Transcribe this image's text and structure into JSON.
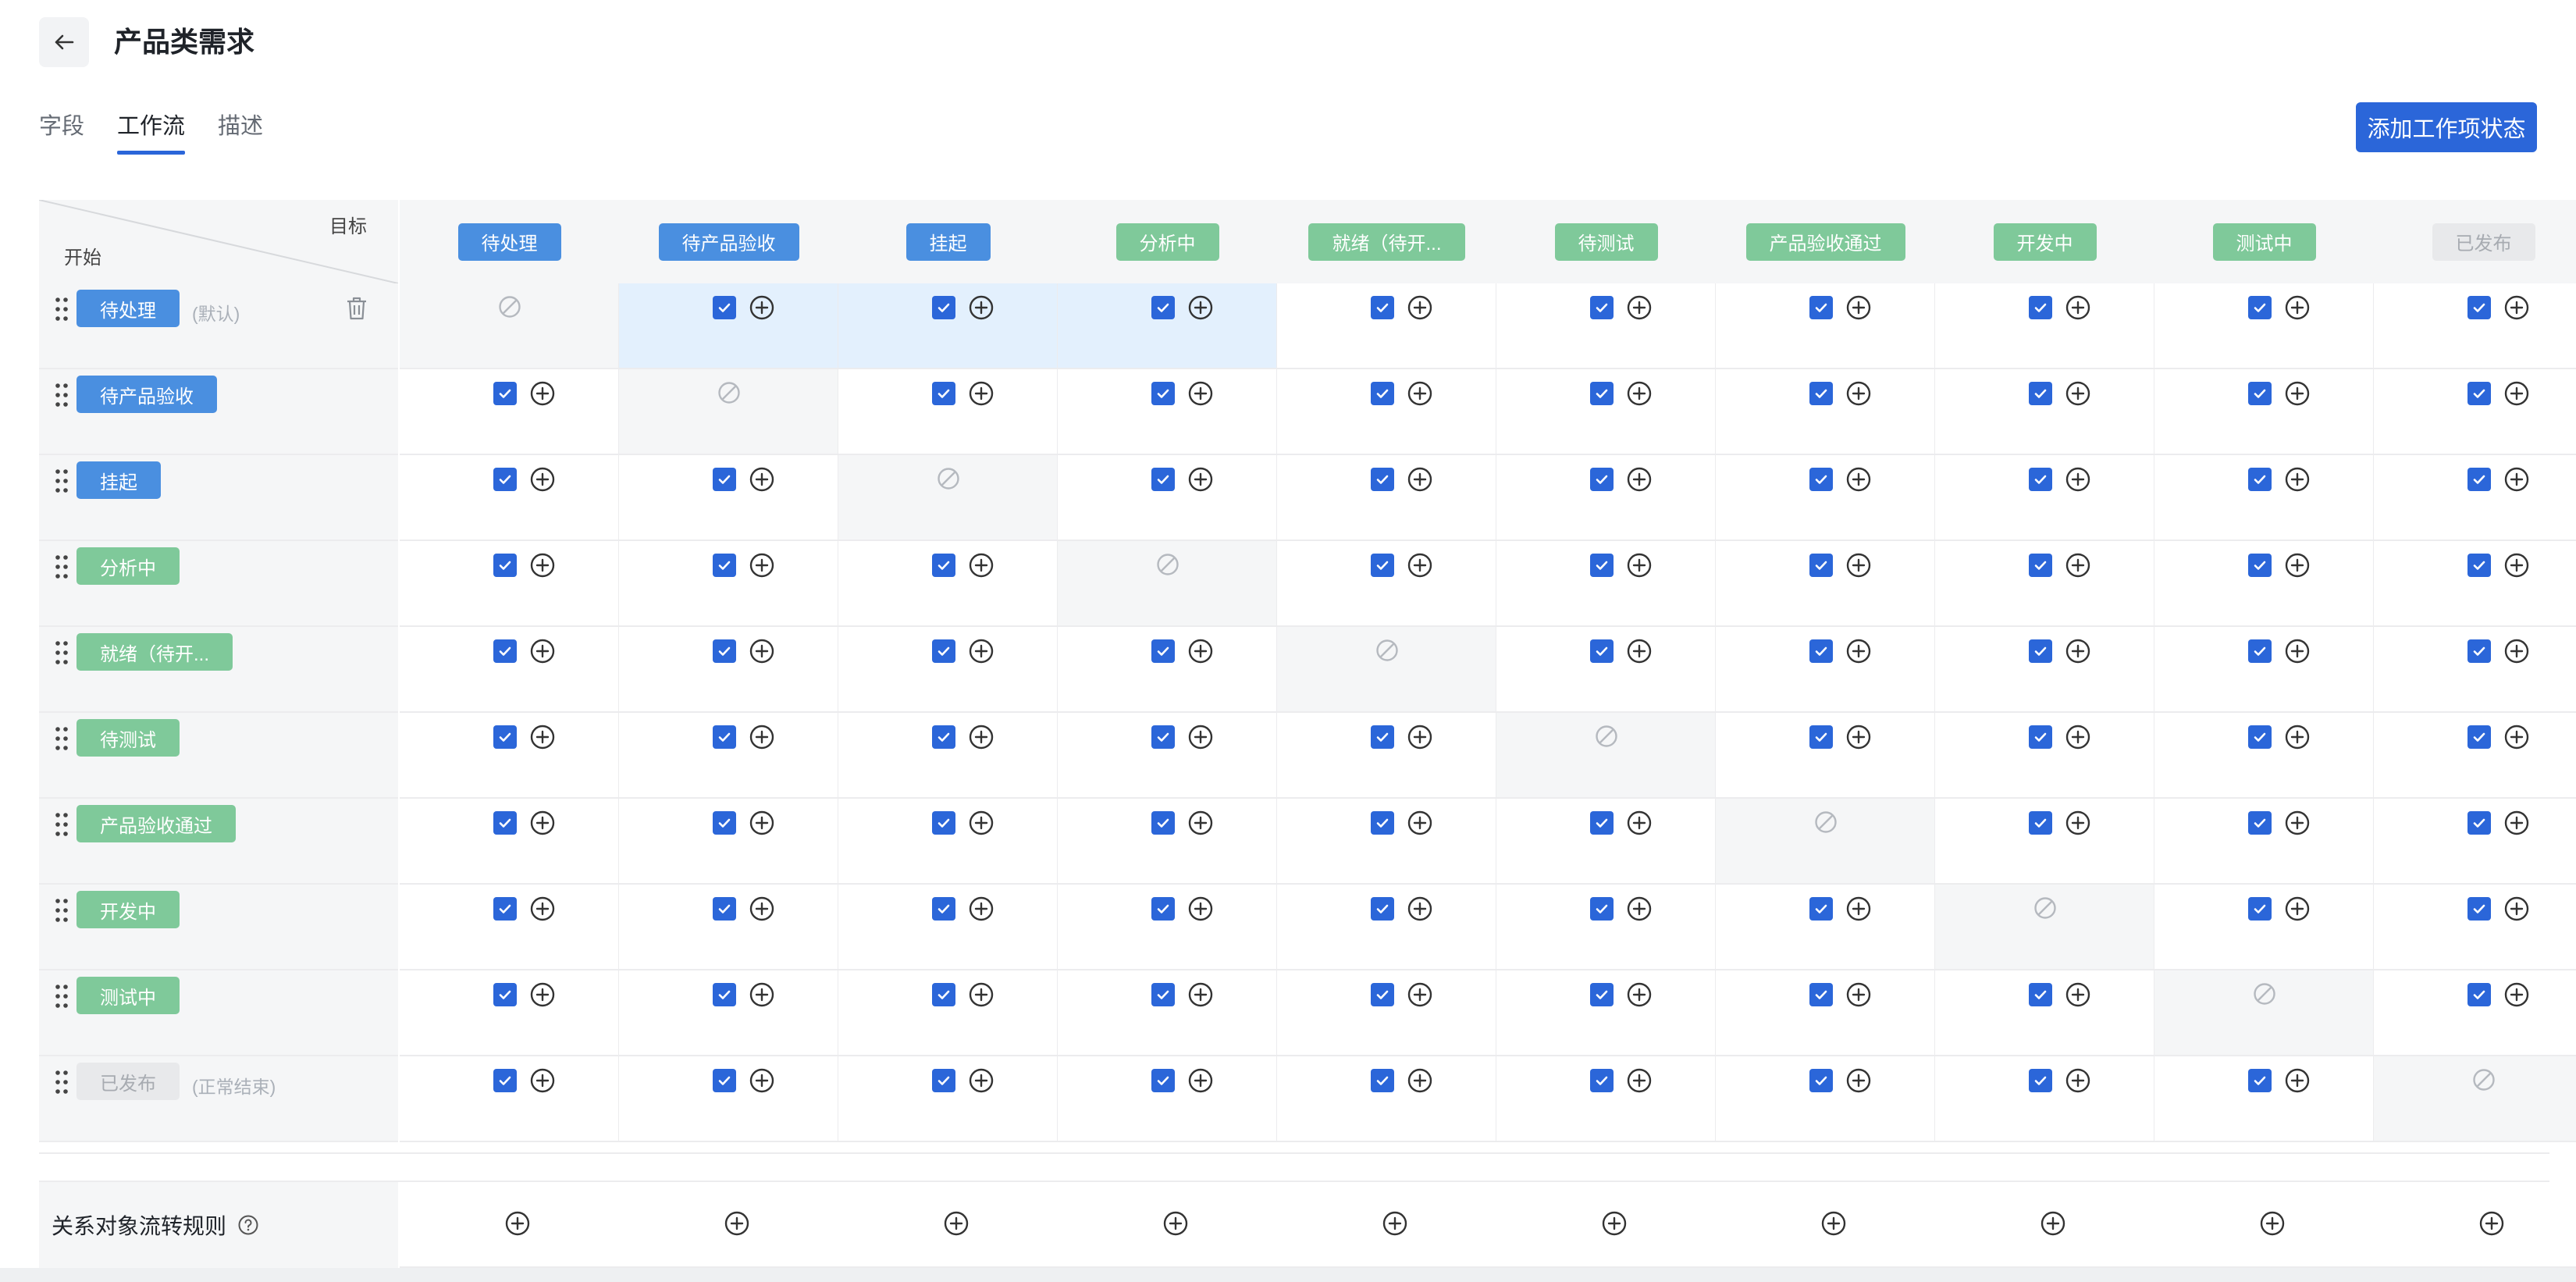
{
  "header": {
    "title": "产品类需求",
    "back_icon": "arrow-left-icon"
  },
  "tabs": [
    {
      "label": "字段",
      "active": false
    },
    {
      "label": "工作流",
      "active": true
    },
    {
      "label": "描述",
      "active": false
    }
  ],
  "add_button": "添加工作项状态",
  "corner": {
    "target_label": "目标",
    "start_label": "开始"
  },
  "statuses": [
    {
      "label": "待处理",
      "color": "blue"
    },
    {
      "label": "待产品验收",
      "color": "blue"
    },
    {
      "label": "挂起",
      "color": "blue"
    },
    {
      "label": "分析中",
      "color": "green"
    },
    {
      "label": "就绪（待开...",
      "color": "green"
    },
    {
      "label": "待测试",
      "color": "green"
    },
    {
      "label": "产品验收通过",
      "color": "green"
    },
    {
      "label": "开发中",
      "color": "green"
    },
    {
      "label": "测试中",
      "color": "green"
    },
    {
      "label": "已发布",
      "color": "gray"
    }
  ],
  "row_notes": {
    "default": "(默认)",
    "end": "(正常结束)"
  },
  "highlighted_cells": [
    [
      0,
      1
    ],
    [
      0,
      2
    ],
    [
      0,
      3
    ]
  ],
  "relation_rule_label": "关系对象流转规则",
  "colors": {
    "primary": "#2b66d9",
    "blue_tag": "#4a8fe0",
    "green_tag": "#7fc99a",
    "gray_tag": "#e8e9eb",
    "highlight": "#e3f0fd",
    "header_bg": "#f5f6f7"
  }
}
